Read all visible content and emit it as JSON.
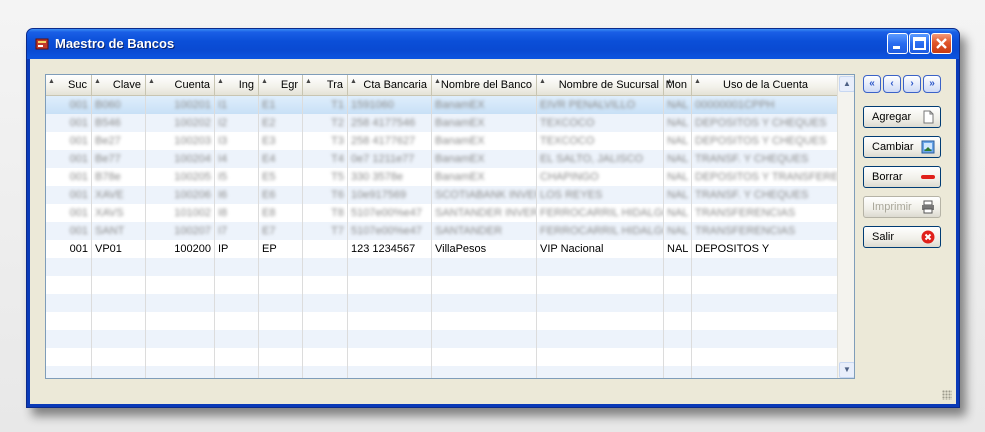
{
  "window": {
    "title": "Maestro de Bancos"
  },
  "table": {
    "columns": [
      {
        "label": "Suc"
      },
      {
        "label": "Clave"
      },
      {
        "label": "Cuenta"
      },
      {
        "label": "Ing"
      },
      {
        "label": "Egr"
      },
      {
        "label": "Tra"
      },
      {
        "label": "Cta Bancaria"
      },
      {
        "label": "Nombre del Banco"
      },
      {
        "label": "Nombre de Sucursal"
      },
      {
        "label": "Mon"
      },
      {
        "label": "Uso de la Cuenta"
      }
    ],
    "rows": [
      [
        "001",
        "B060",
        "100201",
        "I1",
        "E1",
        "T1",
        "1591060",
        "BanamEX",
        "EIVR PENALVILLO",
        "NAL",
        "00000001CPPH"
      ],
      [
        "001",
        "B546",
        "100202",
        "I2",
        "E2",
        "T2",
        "258 4177546",
        "BanamEX",
        "TEXCOCO",
        "NAL",
        "DEPOSITOS Y CHEQUES"
      ],
      [
        "001",
        "Be27",
        "100203",
        "I3",
        "E3",
        "T3",
        "258 4177627",
        "BanamEX",
        "TEXCOCO",
        "NAL",
        "DEPOSITOS Y CHEQUES"
      ],
      [
        "001",
        "Be77",
        "100204",
        "I4",
        "E4",
        "T4",
        "0e7 1211e77",
        "BanamEX",
        "EL SALTO, JALISCO",
        "NAL",
        "TRANSF. Y CHEQUES"
      ],
      [
        "001",
        "B78e",
        "100205",
        "I5",
        "E5",
        "T5",
        "330 3578e",
        "BanamEX",
        "CHAPINGO",
        "NAL",
        "DEPOSITOS Y TRANSFERENC"
      ],
      [
        "001",
        "XAVE",
        "100206",
        "I6",
        "E6",
        "T6",
        "10e917569",
        "SCOTIABANK INVERLA",
        "LOS REYES",
        "NAL",
        "TRANSF. Y CHEQUES"
      ],
      [
        "001",
        "XAVS",
        "101002",
        "I8",
        "E8",
        "T8",
        "5107e00%e47",
        "SANTANDER INVERSIO",
        "FERROCARRIL HIDALGO",
        "NAL",
        "TRANSFERENCIAS"
      ],
      [
        "001",
        "SANT",
        "100207",
        "I7",
        "E7",
        "T7",
        "5107e00%e47",
        "SANTANDER",
        "FERROCARRIL HIDALGO",
        "NAL",
        "TRANSFERENCIAS"
      ],
      [
        "001",
        "VP01",
        "100200",
        "IP",
        "EP",
        "",
        "123 1234567",
        "VillaPesos",
        "VIP Nacional",
        "NAL",
        "DEPOSITOS Y"
      ]
    ],
    "blurred_rows": 8
  },
  "nav": {
    "first": "«",
    "prev": "‹",
    "next": "›",
    "last": "»"
  },
  "actions": {
    "agregar": "Agregar",
    "cambiar": "Cambiar",
    "borrar": "Borrar",
    "imprimir": "Imprimir",
    "salir": "Salir"
  },
  "colors": {
    "title_bar": "#0a4ad2",
    "selection": "#c8e0f6",
    "alt_row": "#edf3fb",
    "client": "#ece9d8"
  }
}
